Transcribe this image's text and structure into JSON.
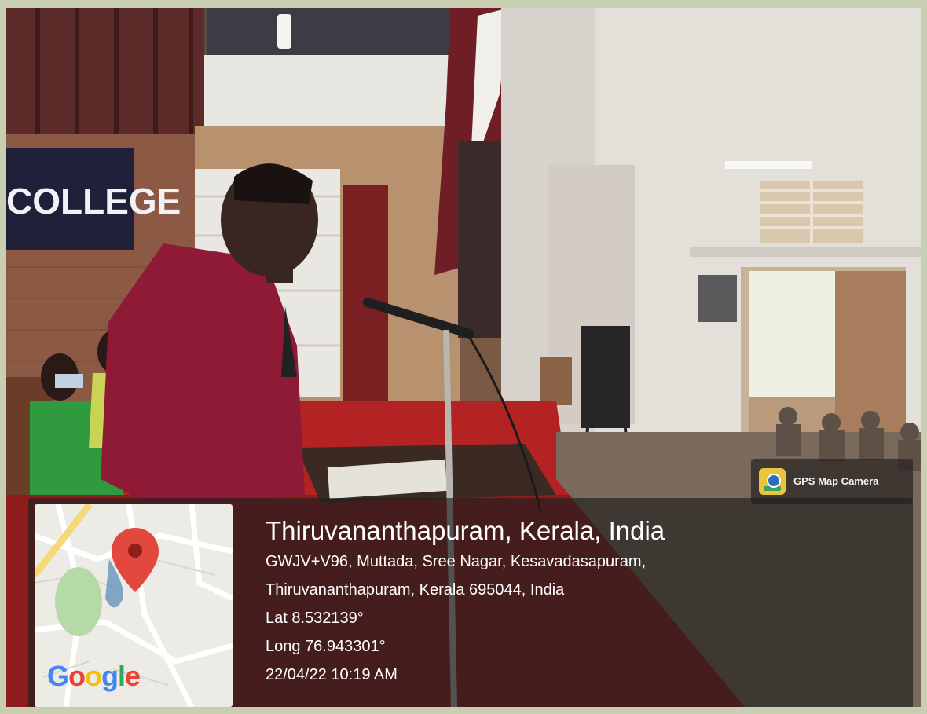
{
  "overlay": {
    "app_name": "GPS Map Camera",
    "app_icon": "gps-map-camera-icon",
    "map_logo": "Google",
    "map_pin_icon": "map-pin-icon",
    "location_title": "Thiruvananthapuram, Kerala, India",
    "address_line_1": "GWJV+V96, Muttada, Sree Nagar, Kesavadasapuram,",
    "address_line_2": "Thiruvananthapuram, Kerala 695044, India",
    "latitude": "Lat 8.532139°",
    "longitude": "Long 76.943301°",
    "datetime": "22/04/22 10:19 AM"
  },
  "scene": {
    "wall_sign": "COLLEGE"
  },
  "colors": {
    "pin_red": "#e2483d",
    "google_blue": "#4285f4",
    "google_red": "#ea4335",
    "google_yellow": "#fbbc05",
    "google_green": "#34a853"
  }
}
